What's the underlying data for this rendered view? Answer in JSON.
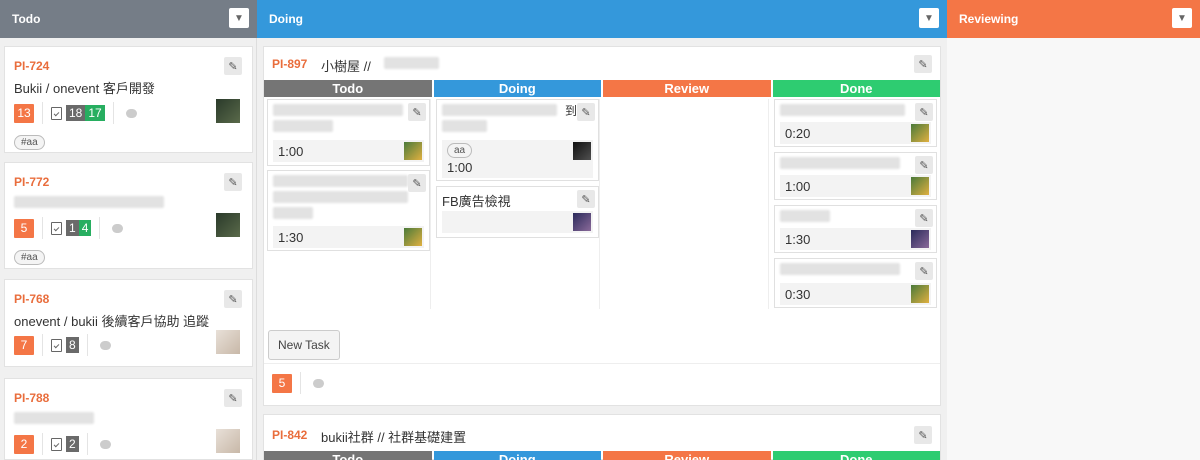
{
  "columns": {
    "todo": "Todo",
    "doing": "Doing",
    "reviewing": "Reviewing"
  },
  "todo_cards": [
    {
      "id": "PI-724",
      "title": "Bukii / onevent 客戶開發",
      "points": "13",
      "done": "18",
      "total": "17",
      "tag": "#aa"
    },
    {
      "id": "PI-772",
      "title": "",
      "points": "5",
      "done": "1",
      "total": "4",
      "tag": "#aa"
    },
    {
      "id": "PI-768",
      "title": "onevent / bukii 後續客戶協助 追蹤",
      "points": "7",
      "done": "8",
      "total": ""
    },
    {
      "id": "PI-788",
      "title": "",
      "points": "2",
      "done": "2",
      "total": ""
    }
  ],
  "doing_cards": [
    {
      "id": "PI-897",
      "title": "小樹屋 //",
      "points": "5",
      "lanes": [
        "Todo",
        "Doing",
        "Review",
        "Done"
      ],
      "new_task": "New Task",
      "tasks": {
        "todo": [
          {
            "time": "1:00"
          },
          {
            "time": "1:30"
          }
        ],
        "doing": [
          {
            "time": "1:00",
            "tag": "aa",
            "tail": "到"
          },
          {
            "title": "FB廣告檢視",
            "time": ""
          }
        ],
        "done": [
          {
            "time": "0:20"
          },
          {
            "time": "1:00"
          },
          {
            "time": "1:30"
          },
          {
            "time": "0:30"
          }
        ]
      }
    },
    {
      "id": "PI-842",
      "title": "bukii社群 // 社群基礎建置",
      "lanes": [
        "Todo",
        "Doing",
        "Review",
        "Done"
      ]
    }
  ],
  "icons": {
    "edit": "pencil-icon",
    "dropdown": "chevron-down-icon",
    "checklist": "clipboard-check-icon",
    "comment": "comment-icon"
  },
  "colors": {
    "todo": "#757d87",
    "doing": "#3498db",
    "review": "#f47646",
    "done": "#2ecc71",
    "id": "#e96d3c"
  }
}
